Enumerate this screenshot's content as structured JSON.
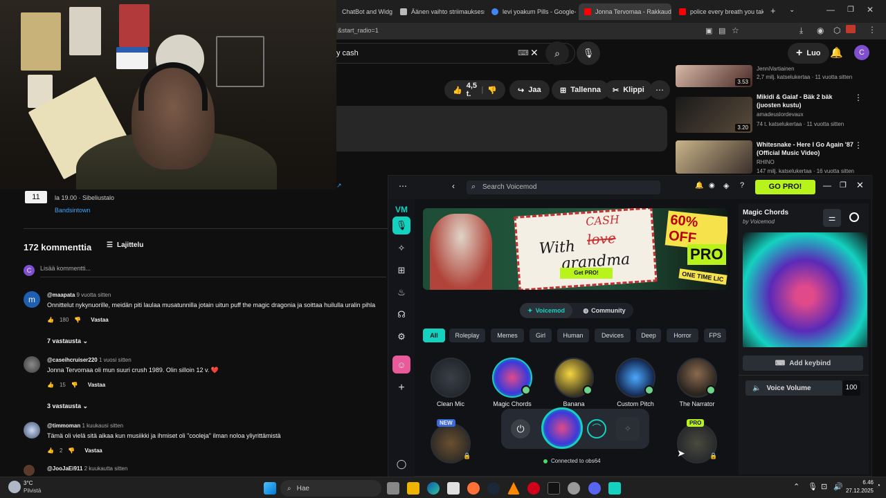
{
  "browser": {
    "tabs": [
      {
        "label": "ChatBot and Widg",
        "color": "#8ab4f8"
      },
      {
        "label": "Äänen vaihto striimauksess",
        "color": "#bbbbbb"
      },
      {
        "label": "levi yoakum Pills - Google-h",
        "color": "#4285f4"
      },
      {
        "label": "Jonna Tervomaa - Rakkaud",
        "color": "#ff0000"
      },
      {
        "label": "police every breath you tak",
        "color": "#ff0000"
      }
    ],
    "url": "&start_radio=1"
  },
  "youtube": {
    "search_value": "y cash",
    "create_label": "Luo",
    "avatar_letter": "C",
    "like_count": "4,5 t.",
    "share_label": "Jaa",
    "save_label": "Tallenna",
    "clip_label": "Klippi",
    "event": {
      "day": "11",
      "time": "la 19.00 · Sibeliustalo",
      "link": "Bandsintown"
    },
    "comments_count": "172 kommenttia",
    "sort_label": "Lajittelu",
    "add_comment_placeholder": "Lisää kommentti...",
    "add_comment_avatar": "C",
    "comments": [
      {
        "user": "@maapata",
        "time": "9 vuotta sitten",
        "text": "Onnittelut nykynuorille, meidän piti laulaa musatunnilla jotain uitun puff the magic dragonia ja soittaa huilulla uralin pihla",
        "likes": "180",
        "reply": "Vastaa",
        "replies": "7 vastausta",
        "avatar_letter": "m"
      },
      {
        "user": "@caseihcruiser220",
        "time": "1 vuosi sitten",
        "text": "Jonna Tervomaa oli mun suuri crush 1989. Olin silloin 12 v. ❤️",
        "likes": "15",
        "reply": "Vastaa",
        "replies": "3 vastausta"
      },
      {
        "user": "@timmoman",
        "time": "1 kuukausi sitten",
        "text": "Tämä oli vielä sitä aikaa kun musiikki ja ihmiset oli \"cooleja\" ilman noloa yliyrittämistä",
        "likes": "2",
        "reply": "Vastaa"
      },
      {
        "user": "@JooJaEi911",
        "time": "2 kuukautta sitten"
      }
    ],
    "recommendations": [
      {
        "title": "",
        "channel": "JenniVartiainen",
        "meta": "2,7 milj. katselukertaa · 11 vuotta sitten",
        "duration": "3.53"
      },
      {
        "title": "Mikidi & Gaiaf - Bäk 2 bäk (juosten kustu)",
        "channel": "amadeuslordevaux",
        "meta": "74 t. katselukertaa · 11 vuotta sitten",
        "duration": "3.20"
      },
      {
        "title": "Whitesnake - Here I Go Again '87 (Official Music Video)",
        "channel": "RHINO",
        "meta": "147 milj. katselukertaa · 16 vuotta sitten",
        "duration": ""
      }
    ]
  },
  "voicemod": {
    "search_placeholder": "Search Voicemod",
    "gopro_label": "GO PRO!",
    "banner": {
      "line1": "With",
      "crossed": "love",
      "cash": "CASH",
      "line2": "grandma",
      "cta": "Get PRO!",
      "off": "60% OFF",
      "pro": "PRO",
      "onetime": "ONE TIME LIC"
    },
    "tabs": {
      "voicemod": "Voicemod",
      "community": "Community"
    },
    "filters": [
      "All",
      "Roleplay",
      "Memes",
      "Girl",
      "Human",
      "Devices",
      "Deep",
      "Horror",
      "FPS"
    ],
    "voices": [
      {
        "name": "Clean Mic"
      },
      {
        "name": "Magic Chords"
      },
      {
        "name": "Banana"
      },
      {
        "name": "Custom Pitch"
      },
      {
        "name": "The Narrator"
      }
    ],
    "badges": {
      "new": "NEW",
      "pro": "PRO"
    },
    "connected_text": "Connected to obs64",
    "selected": {
      "title": "Magic Chords",
      "author": "by Voicemod",
      "keybind_label": "Add keybind",
      "volume_label": "Voice Volume",
      "volume_value": "100"
    }
  },
  "taskbar": {
    "weather_temp": "3°C",
    "weather_desc": "Pilvistä",
    "search_placeholder": "Hae",
    "time": "6.46",
    "date": "27.12.2025"
  }
}
